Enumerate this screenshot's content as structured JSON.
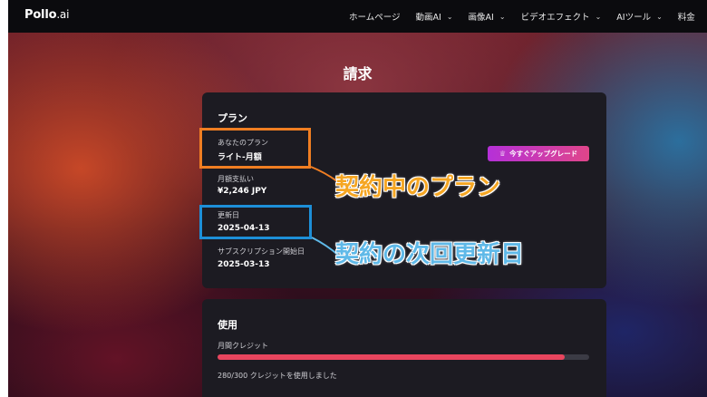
{
  "nav": {
    "logo": "Pollo",
    "logo_suffix": ".ai",
    "items": [
      {
        "label": "ホームページ",
        "has_dropdown": false
      },
      {
        "label": "動画AI",
        "has_dropdown": true
      },
      {
        "label": "画像AI",
        "has_dropdown": true
      },
      {
        "label": "ビデオエフェクト",
        "has_dropdown": true
      },
      {
        "label": "AIツール",
        "has_dropdown": true
      },
      {
        "label": "料金",
        "has_dropdown": false
      }
    ]
  },
  "page": {
    "title": "請求"
  },
  "plan": {
    "title": "プラン",
    "current_plan_label": "あなたのプラン",
    "current_plan_value": "ライト-月額",
    "monthly_payment_label": "月額支払い",
    "monthly_payment_value": "¥2,246 JPY",
    "renewal_label": "更新日",
    "renewal_value": "2025-04-13",
    "start_label": "サブスクリプション開始日",
    "start_value": "2025-03-13",
    "upgrade_button": "今すぐアップグレード"
  },
  "usage": {
    "title": "使用",
    "credits_label": "月間クレジット",
    "credits_used": 280,
    "credits_total": 300,
    "credits_note": "280/300 クレジットを使用しました"
  },
  "annotations": {
    "current_plan": "契約中のプラン",
    "next_renewal": "契約の次回更新日"
  },
  "colors": {
    "accent_orange": "#f07e22",
    "accent_blue": "#1d8fd8",
    "progress": "#e8455e",
    "upgrade_start": "#b530d8",
    "upgrade_end": "#e0458a"
  }
}
